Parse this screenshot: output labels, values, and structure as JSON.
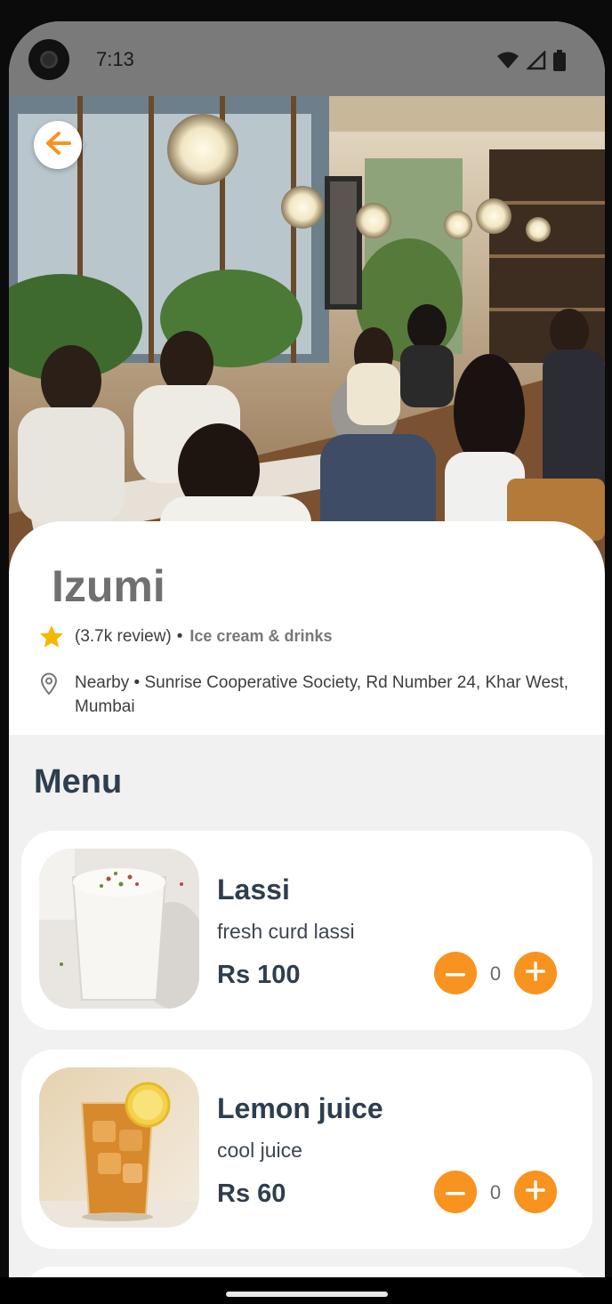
{
  "status_bar": {
    "time": "7:13",
    "icons": [
      "wifi-icon",
      "signal-icon",
      "battery-icon"
    ]
  },
  "header": {
    "back_icon": "arrow-left-icon",
    "hero_image": "restaurant interior photo"
  },
  "restaurant": {
    "name": "Izumi",
    "reviews": "(3.7k review)",
    "separator": "•",
    "category": "Ice cream & drinks",
    "address": "Nearby • Sunrise Cooperative Society, Rd Number 24, Khar West, Mumbai"
  },
  "menu": {
    "title": "Menu",
    "items": [
      {
        "name": "Lassi",
        "description": "fresh curd lassi",
        "price": "Rs 100",
        "quantity": "0"
      },
      {
        "name": "Lemon juice",
        "description": "cool juice",
        "price": "Rs 60",
        "quantity": "0"
      }
    ]
  },
  "colors": {
    "accent": "#f7931e",
    "star": "#f5b800",
    "heading": "#2f3e4e",
    "background": "#f1f1f1"
  }
}
